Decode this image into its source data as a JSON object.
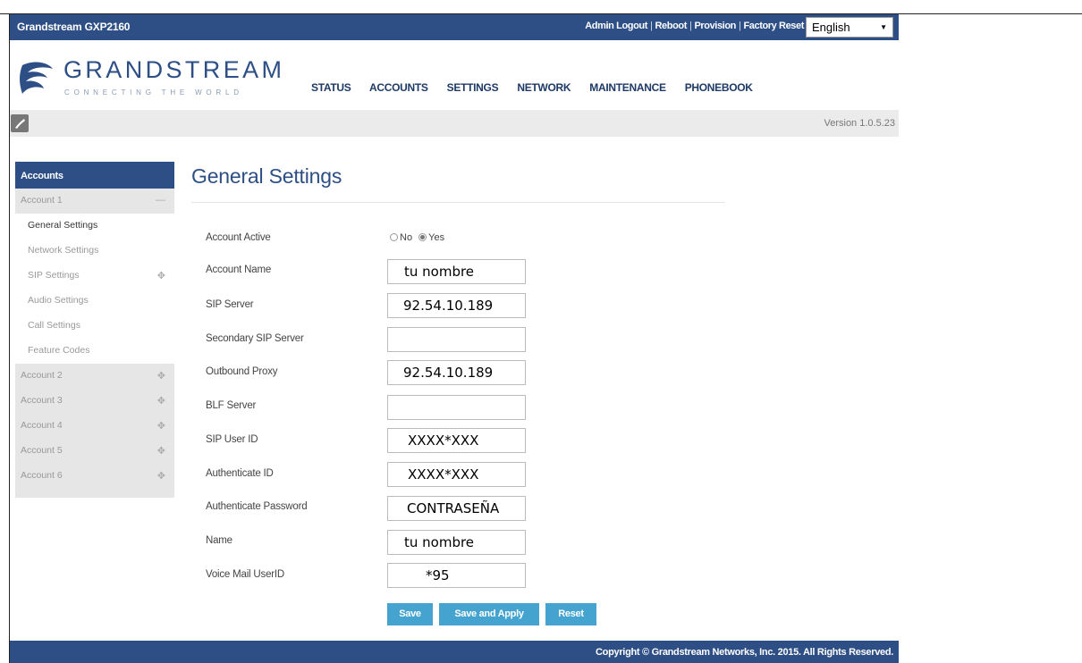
{
  "topbar": {
    "brand": "Grandstream GXP2160",
    "links": [
      "Admin Logout",
      "Reboot",
      "Provision",
      "Factory Reset"
    ],
    "language": "English"
  },
  "logo": {
    "word": "GRANDSTREAM",
    "tagline": "CONNECTING THE WORLD"
  },
  "nav": [
    "STATUS",
    "ACCOUNTS",
    "SETTINGS",
    "NETWORK",
    "MAINTENANCE",
    "PHONEBOOK"
  ],
  "version": "Version 1.0.5.23",
  "sidebar": {
    "header": "Accounts",
    "items": [
      {
        "label": "Account 1",
        "icon": "—"
      },
      {
        "label": "General Settings",
        "icon": ""
      },
      {
        "label": "Network Settings",
        "icon": ""
      },
      {
        "label": "SIP Settings",
        "icon": "✥"
      },
      {
        "label": "Audio Settings",
        "icon": ""
      },
      {
        "label": "Call Settings",
        "icon": ""
      },
      {
        "label": "Feature Codes",
        "icon": ""
      },
      {
        "label": "Account 2",
        "icon": "✥"
      },
      {
        "label": "Account 3",
        "icon": "✥"
      },
      {
        "label": "Account 4",
        "icon": "✥"
      },
      {
        "label": "Account 5",
        "icon": "✥"
      },
      {
        "label": "Account 6",
        "icon": "✥"
      }
    ]
  },
  "main": {
    "title": "General Settings",
    "account_active": {
      "label": "Account Active",
      "no": "No",
      "yes": "Yes",
      "selected": "Yes"
    },
    "fields": [
      {
        "label": "Account Name",
        "value": "tu nombre"
      },
      {
        "label": "SIP Server",
        "value": "92.54.10.189"
      },
      {
        "label": "Secondary SIP Server",
        "value": ""
      },
      {
        "label": "Outbound Proxy",
        "value": "92.54.10.189"
      },
      {
        "label": "BLF Server",
        "value": ""
      },
      {
        "label": "SIP User ID",
        "value": "XXXX*XXX"
      },
      {
        "label": "Authenticate ID",
        "value": "XXXX*XXX"
      },
      {
        "label": "Authenticate Password",
        "value": "CONTRASEÑA"
      },
      {
        "label": "Name",
        "value": "tu nombre"
      },
      {
        "label": "Voice Mail UserID",
        "value": "*95"
      }
    ],
    "buttons": {
      "save": "Save",
      "save_apply": "Save and Apply",
      "reset": "Reset"
    }
  },
  "footer": {
    "copyright": "Copyright © Grandstream Networks, Inc. 2015. All Rights Reserved."
  },
  "colors": {
    "brand_blue": "#2d4f85",
    "button_blue": "#45a3cf",
    "bar_grey": "#ebebeb"
  }
}
